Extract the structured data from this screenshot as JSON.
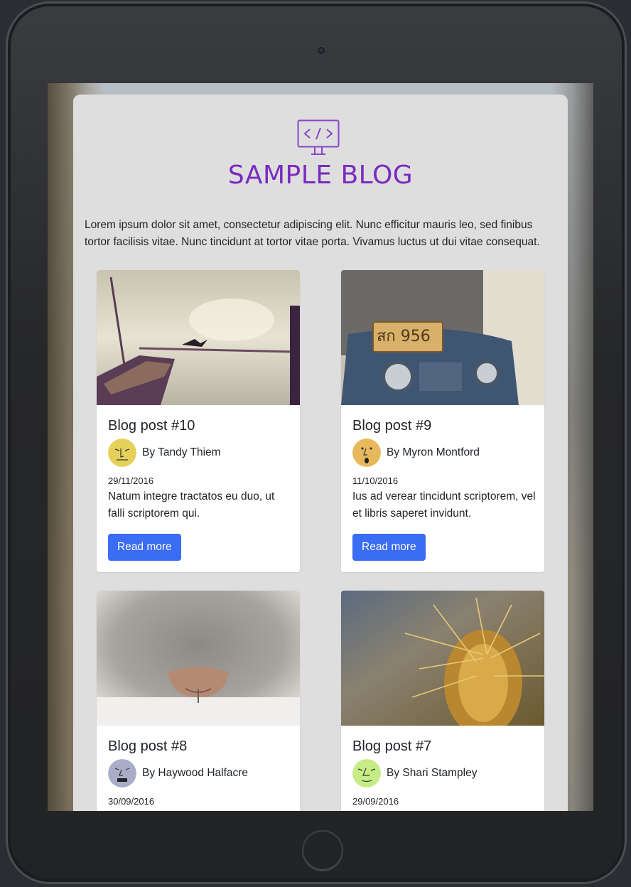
{
  "site": {
    "title": "SAMPLE BLOG",
    "logo_icon": "monitor-code-icon",
    "intro": "Lorem ipsum dolor sit amet, consectetur adipiscing elit. Nunc efficitur mauris leo, sed finibus tortor facilisis vitae. Nunc tincidunt at tortor vitae porta. Vivamus luctus ut dui vitae consequat."
  },
  "colors": {
    "title": "#7a2bc0",
    "button": "#3a6cf4",
    "panel": "#dedede"
  },
  "posts": [
    {
      "title": "Blog post #10",
      "author": "By Tandy Thiem",
      "date": "29/11/2016",
      "excerpt": "Natum integre tractatos eu duo, ut falli scriptorem qui.",
      "button": "Read more",
      "image": "boat-dock-photo",
      "avatar": "yellow-face-avatar"
    },
    {
      "title": "Blog post #9",
      "author": "By Myron Montford",
      "date": "11/10/2016",
      "excerpt": "Ius ad verear tincidunt scriptorem, vel et libris saperet invidunt.",
      "button": "Read more",
      "image": "tuk-tuk-photo",
      "avatar": "orange-face-avatar"
    },
    {
      "title": "Blog post #8",
      "author": "By Haywood Halfacre",
      "date": "30/09/2016",
      "image": "cat-nose-photo",
      "avatar": "grey-face-avatar"
    },
    {
      "title": "Blog post #7",
      "author": "By Shari Stampley",
      "date": "29/09/2016",
      "image": "cactus-photo",
      "avatar": "green-face-avatar"
    }
  ]
}
